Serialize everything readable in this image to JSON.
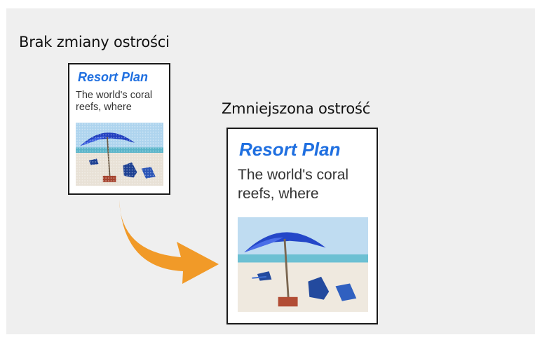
{
  "labels": {
    "before": "Brak zmiany ostrości",
    "after": "Zmniejszona ostrość"
  },
  "sample_document": {
    "title": "Resort Plan",
    "text_line1": "The world's coral",
    "text_line2": "reefs, where",
    "photo_icon": "beach-umbrella-photo"
  },
  "colors": {
    "title_blue": "#1f6fe0",
    "arrow_orange": "#f19a28",
    "panel_gray": "#efefef"
  }
}
